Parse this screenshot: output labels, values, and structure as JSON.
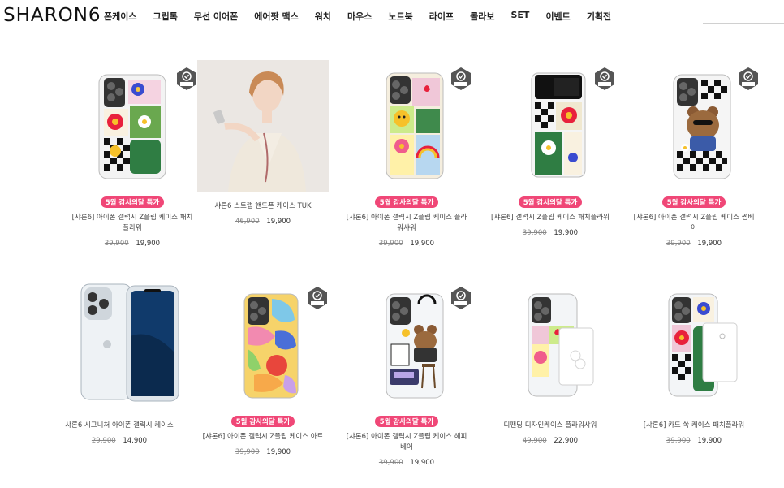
{
  "header": {
    "logo": "SHARON6",
    "nav": [
      "폰케이스",
      "그립톡",
      "무선 이어폰",
      "에어팟 맥스",
      "워치",
      "마우스",
      "노트북",
      "라이프",
      "콜라보",
      "SET",
      "이벤트",
      "기획전"
    ]
  },
  "products": [
    {
      "sale": "5월 감사의달 특가",
      "name": "[샤론6] 아이폰 갤럭시 Z플립 케이스 패치플라워",
      "old_price": "39,900",
      "price": "19,900",
      "drop_badge": "Drop Test PASS"
    },
    {
      "sale": "",
      "name": "샤론6 스트랩 핸드폰 케이스 TUK",
      "old_price": "46,900",
      "price": "19,900",
      "drop_badge": ""
    },
    {
      "sale": "5월 감사의달 특가",
      "name": "[샤론6] 아이폰 갤럭시 Z플립 케이스 플라워샤워",
      "old_price": "39,900",
      "price": "19,900",
      "drop_badge": "Drop Test PASS"
    },
    {
      "sale": "5월 감사의달 특가",
      "name": "[샤론6] 갤럭시 Z플립 케이스 패치플라워",
      "old_price": "39,900",
      "price": "19,900",
      "drop_badge": "Drop Test PASS"
    },
    {
      "sale": "5월 감사의달 특가",
      "name": "[샤론6] 아이폰 갤럭시 Z플립 케이스 썸베어",
      "old_price": "39,900",
      "price": "19,900",
      "drop_badge": "Drop Test PASS"
    },
    {
      "sale": "",
      "name": "샤론6 시그니처 아이폰 갤럭시 케이스",
      "old_price": "29,900",
      "price": "14,900",
      "drop_badge": ""
    },
    {
      "sale": "5월 감사의달 특가",
      "name": "[샤론6] 아이폰 갤럭시 Z플립 케이스 아트",
      "old_price": "39,900",
      "price": "19,900",
      "drop_badge": "Drop Test PASS"
    },
    {
      "sale": "5월 감사의달 특가",
      "name": "[샤론6] 아이폰 갤럭시 Z플립 케이스 해피베어",
      "old_price": "39,900",
      "price": "19,900",
      "drop_badge": "Drop Test PASS"
    },
    {
      "sale": "",
      "name": "디팬딩 디자인케이스 플라워샤워",
      "old_price": "49,900",
      "price": "22,900",
      "drop_badge": ""
    },
    {
      "sale": "",
      "name": "[샤론6] 카드 쏙 케이스 패치플라워",
      "old_price": "39,900",
      "price": "19,900",
      "drop_badge": ""
    }
  ],
  "colors": {
    "sale_badge": "#f04777",
    "accent": "#222222"
  }
}
